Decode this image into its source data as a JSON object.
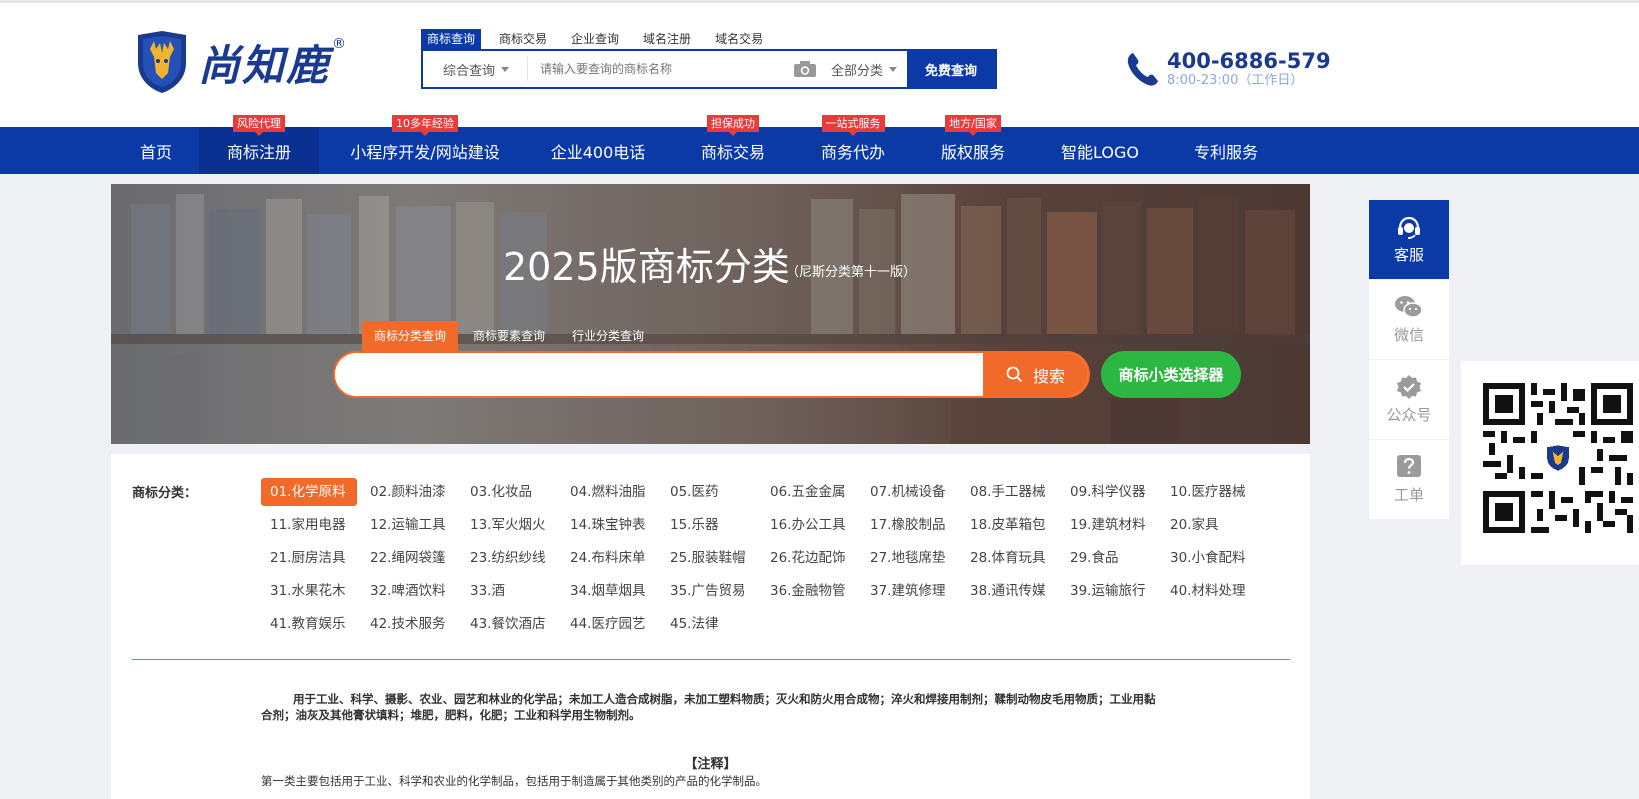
{
  "logo": {
    "text": "尚知鹿",
    "reg": "®"
  },
  "search": {
    "tabs": [
      "商标查询",
      "商标交易",
      "企业查询",
      "域名注册",
      "域名交易"
    ],
    "scope": "综合查询",
    "placeholder": "请输入要查询的商标名称",
    "category": "全部分类",
    "button": "免费查询"
  },
  "contact": {
    "phone": "400-6886-579",
    "hours": "8:00-23:00（工作日）"
  },
  "nav": {
    "items": [
      {
        "label": "首页",
        "badge": ""
      },
      {
        "label": "商标注册",
        "badge": "风险代理"
      },
      {
        "label": "小程序开发/网站建设",
        "badge": "10多年经验"
      },
      {
        "label": "企业400电话",
        "badge": ""
      },
      {
        "label": "商标交易",
        "badge": "担保成功"
      },
      {
        "label": "商务代办",
        "badge": "一站式服务"
      },
      {
        "label": "版权服务",
        "badge": "地方/国家"
      },
      {
        "label": "智能LOGO",
        "badge": ""
      },
      {
        "label": "专利服务",
        "badge": ""
      }
    ],
    "active_index": 1
  },
  "banner": {
    "title": "2025版商标分类",
    "subtitle": "（尼斯分类第十一版）",
    "tabs": [
      "商标分类查询",
      "商标要素查询",
      "行业分类查询"
    ],
    "search_button": "搜索",
    "picker_button": "商标小类选择器"
  },
  "classification": {
    "label": "商标分类：",
    "items": [
      "01.化学原料",
      "02.颜料油漆",
      "03.化妆品",
      "04.燃料油脂",
      "05.医药",
      "06.五金金属",
      "07.机械设备",
      "08.手工器械",
      "09.科学仪器",
      "10.医疗器械",
      "11.家用电器",
      "12.运输工具",
      "13.军火烟火",
      "14.珠宝钟表",
      "15.乐器",
      "16.办公工具",
      "17.橡胶制品",
      "18.皮革箱包",
      "19.建筑材料",
      "20.家具",
      "21.厨房洁具",
      "22.绳网袋篷",
      "23.纺织纱线",
      "24.布料床单",
      "25.服装鞋帽",
      "26.花边配饰",
      "27.地毯席垫",
      "28.体育玩具",
      "29.食品",
      "30.小食配料",
      "31.水果花木",
      "32.啤酒饮料",
      "33.酒",
      "34.烟草烟具",
      "35.广告贸易",
      "36.金融物管",
      "37.建筑修理",
      "38.通讯传媒",
      "39.运输旅行",
      "40.材料处理",
      "41.教育娱乐",
      "42.技术服务",
      "43.餐饮酒店",
      "44.医疗园艺",
      "45.法律"
    ],
    "active_index": 0,
    "description": "用于工业、科学、摄影、农业、园艺和林业的化学品；未加工人造合成树脂，未加工塑料物质；灭火和防火用合成物；淬火和焊接用制剂；鞣制动物皮毛用物质；工业用黏合剂；油灰及其他膏状填料；堆肥，肥料，化肥；工业和科学用生物制剂。",
    "note_title": "【注释】",
    "note_text": "第一类主要包括用于工业、科学和农业的化学制品，包括用于制造属于其他类别的产品的化学制品。"
  },
  "sidebar": {
    "items": [
      {
        "label": "客服",
        "icon": "headset-icon"
      },
      {
        "label": "微信",
        "icon": "wechat-icon"
      },
      {
        "label": "公众号",
        "icon": "verified-icon"
      },
      {
        "label": "工单",
        "icon": "question-icon"
      }
    ],
    "active_index": 0
  },
  "colors": {
    "brand_blue": "#0b3aa6",
    "accent_orange": "#f26a2a",
    "green": "#2cb642",
    "badge_red": "#e83b3b"
  }
}
